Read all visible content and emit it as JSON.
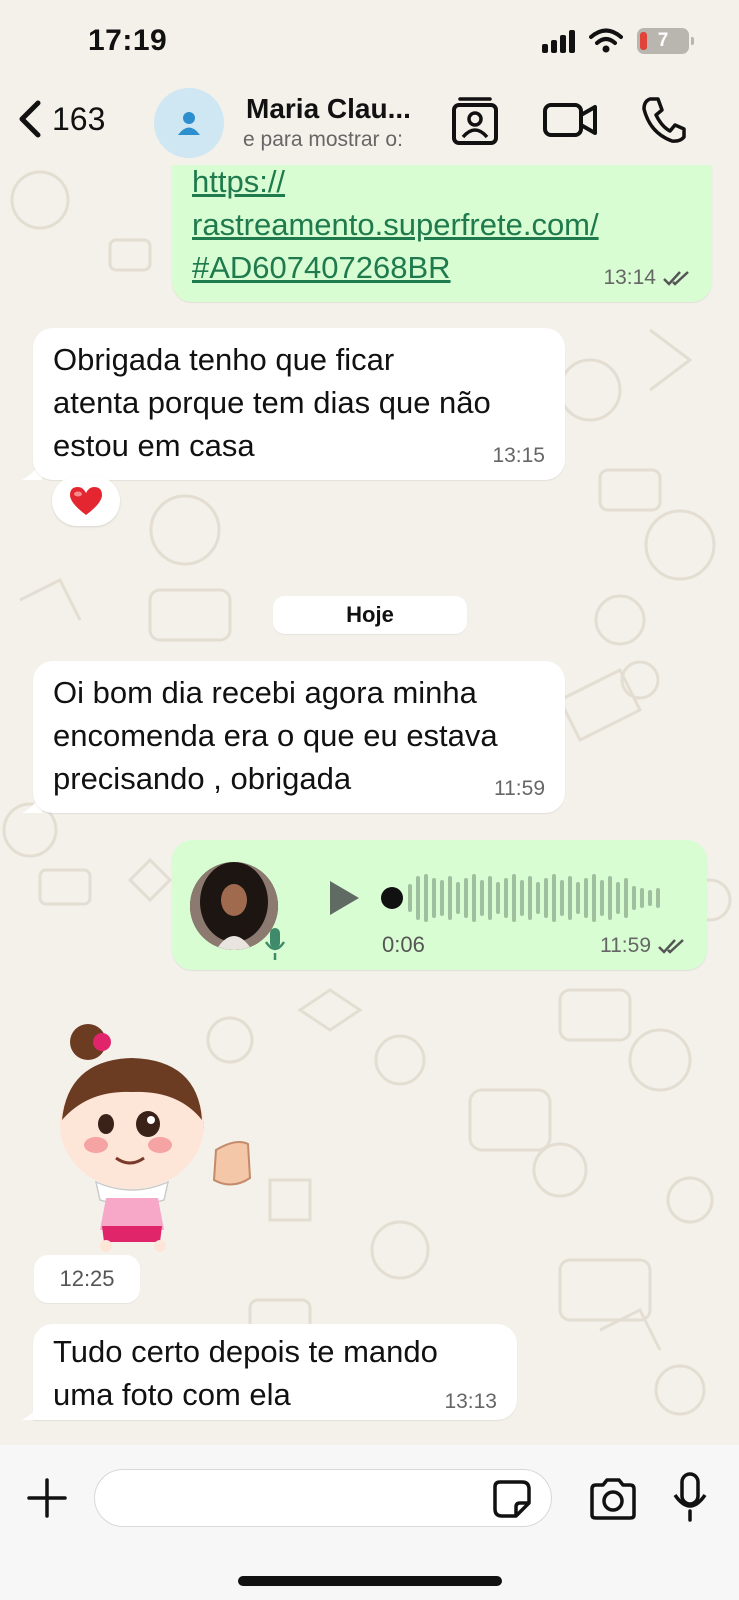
{
  "status_bar": {
    "time": "17:19",
    "battery": "7"
  },
  "header": {
    "back_count": "163",
    "contact_name": "Maria Clau...",
    "contact_subtitle": "e para mostrar o:"
  },
  "messages": [
    {
      "id": "m1",
      "direction": "out",
      "link_lines": [
        "https://",
        "rastreamento.superfrete.com/",
        "#AD607407268BR"
      ],
      "time": "13:14",
      "status": "read"
    },
    {
      "id": "m2",
      "direction": "in",
      "lines": [
        "Obrigada tenho que ficar",
        "atenta porque tem dias que não",
        "estou em casa"
      ],
      "time": "13:15",
      "reaction": "heart"
    },
    {
      "id": "m3",
      "direction": "in",
      "lines": [
        "Oi bom dia  recebi agora minha",
        "encomenda era o que eu estava",
        "precisando , obrigada"
      ],
      "time": "11:59"
    },
    {
      "id": "m4",
      "direction": "out",
      "type": "voice",
      "duration": "0:06",
      "time": "11:59",
      "status": "read"
    },
    {
      "id": "m5",
      "direction": "in",
      "type": "sticker",
      "time": "12:25"
    },
    {
      "id": "m6",
      "direction": "in",
      "lines": [
        "Tudo certo depois te mando",
        "uma foto com ela"
      ],
      "time": "13:13"
    }
  ],
  "date_divider": "Hoje",
  "composer": {
    "placeholder": ""
  },
  "colors": {
    "out_bubble": "#d9fdd3",
    "in_bubble": "#ffffff",
    "link": "#1f7a4e",
    "background": "#f4f1ea"
  }
}
